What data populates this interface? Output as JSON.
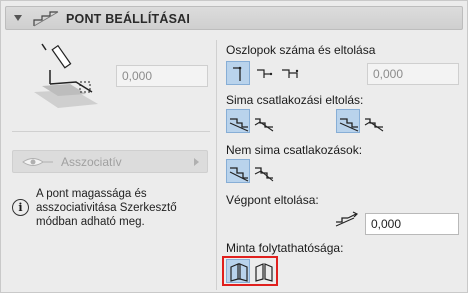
{
  "header": {
    "title": "PONT BEÁLLÍTÁSAI",
    "collapse_icon": "triangle-down-icon",
    "header_icon": "stair-point-icon"
  },
  "left": {
    "height_value": "0,000",
    "assoc_label": "Asszociatív",
    "info_text": "A pont magassága és asszociativitása Szerkesztő módban adható meg."
  },
  "right": {
    "columns_label": "Oszlopok száma és eltolása",
    "columns_value": "0,000",
    "smooth_label": "Sima csatlakozási eltolás:",
    "nonsmooth_label": "Nem sima csatlakozások:",
    "endpoint_label": "Végpont eltolása:",
    "endpoint_value": "0,000",
    "pattern_label": "Minta folytathatósága:"
  },
  "colors": {
    "selected_bg": "#b9d3ec",
    "highlight_red": "#e0201e"
  }
}
